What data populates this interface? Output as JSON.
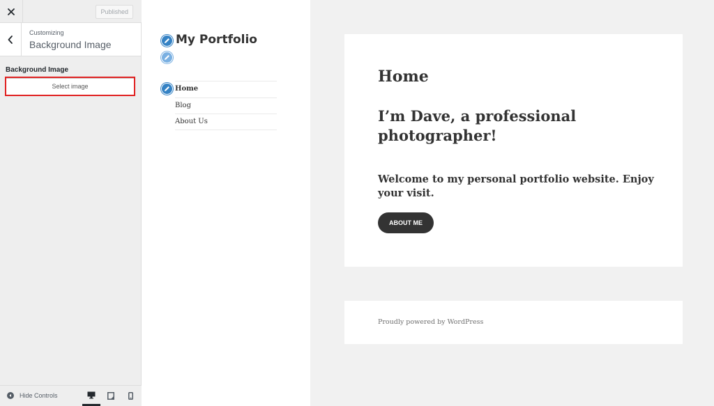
{
  "sidebar": {
    "close_icon": "close-icon",
    "publish_label": "Published",
    "breadcrumb": "Customizing",
    "section_title": "Background Image",
    "control_label": "Background Image",
    "select_image_label": "Select image",
    "hide_controls_label": "Hide Controls",
    "devices": [
      "desktop",
      "tablet",
      "mobile"
    ],
    "active_device": "desktop"
  },
  "preview": {
    "site_title": "My Portfolio",
    "nav_items": [
      "Home",
      "Blog",
      "About Us"
    ],
    "current_nav": "Home",
    "page_heading": "Home",
    "intro": "I’m Dave, a professional photographer!",
    "welcome": "Welcome to my personal portfolio website. Enjoy your visit.",
    "about_button": "ABOUT ME",
    "footer_text": "Proudly powered by WordPress"
  },
  "colors": {
    "accent": "#3582c4",
    "highlight": "#e02020",
    "button_dark": "#333333"
  }
}
